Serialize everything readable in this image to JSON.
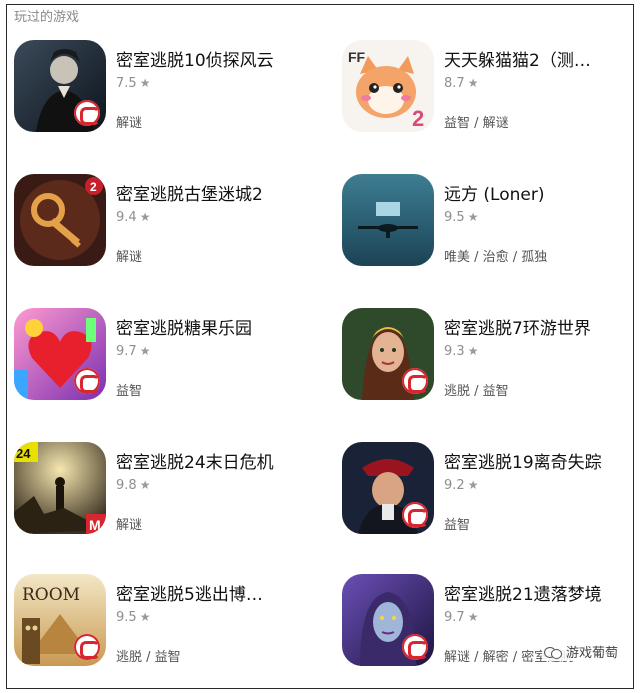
{
  "section": {
    "title": "玩过的游戏"
  },
  "star_char": "★",
  "watermark": {
    "text": "游戏葡萄"
  },
  "games": [
    {
      "title": "密室逃脱10侦探风云",
      "rating": "7.5",
      "tags": "解谜"
    },
    {
      "title": "天天躲猫猫2（测…",
      "rating": "8.7",
      "tags": "益智 / 解谜"
    },
    {
      "title": "密室逃脱古堡迷城2",
      "rating": "9.4",
      "tags": "解谜"
    },
    {
      "title": "远方 (Loner)",
      "rating": "9.5",
      "tags": "唯美 / 治愈 / 孤独"
    },
    {
      "title": "密室逃脱糖果乐园",
      "rating": "9.7",
      "tags": "益智"
    },
    {
      "title": "密室逃脱7环游世界",
      "rating": "9.3",
      "tags": "逃脱 / 益智"
    },
    {
      "title": "密室逃脱24末日危机",
      "rating": "9.8",
      "tags": "解谜"
    },
    {
      "title": "密室逃脱19离奇失踪",
      "rating": "9.2",
      "tags": "益智"
    },
    {
      "title": "密室逃脱5逃出博…",
      "rating": "9.5",
      "tags": "逃脱 / 益智"
    },
    {
      "title": "密室逃脱21遗落梦境",
      "rating": "9.7",
      "tags": "解谜 / 解密 / 密室逃脱"
    }
  ],
  "icon_badges": {
    "game_1": "",
    "game_3": "2",
    "game_2": "2",
    "game_4": "",
    "game_7": "24",
    "game_9": "ROOM"
  },
  "colors": {
    "badge_red": "#d6262f",
    "meta_gray": "#8e8e8e"
  }
}
